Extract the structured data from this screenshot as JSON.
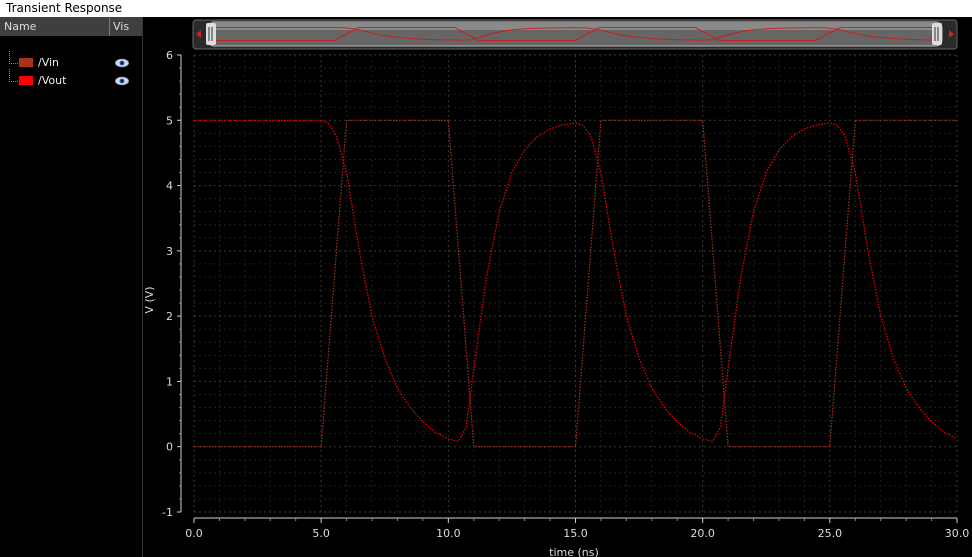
{
  "window": {
    "title": "Transient Response"
  },
  "legend": {
    "header": {
      "name": "Name",
      "vis": "Vis"
    },
    "items": [
      {
        "label": "/Vin",
        "color": "#a8321e",
        "visible_icon": "eye-icon"
      },
      {
        "label": "/Vout",
        "color": "#ff0000",
        "visible_icon": "eye-icon"
      }
    ]
  },
  "chart_data": {
    "type": "line",
    "xlabel": "time (ns)",
    "ylabel": "V (V)",
    "xlim": [
      0,
      30
    ],
    "ylim": [
      -1,
      6
    ],
    "xticks": [
      "0.0",
      "5.0",
      "10.0",
      "15.0",
      "20.0",
      "25.0",
      "30.0"
    ],
    "yticks": [
      "-1",
      "0",
      "1",
      "2",
      "3",
      "4",
      "5",
      "6"
    ],
    "grid": true,
    "series": [
      {
        "name": "/Vin",
        "color": "#a8321e",
        "x": [
          0,
          5.0,
          6.0,
          10.0,
          11.0,
          15.0,
          16.0,
          20.0,
          21.0,
          25.0,
          26.0,
          30.0
        ],
        "y": [
          0,
          0,
          5,
          5,
          0,
          0,
          5,
          5,
          0,
          0,
          5,
          5
        ]
      },
      {
        "name": "/Vout",
        "color": "#ff0000",
        "x": [
          0,
          5.0,
          5.3,
          5.6,
          6.0,
          6.5,
          7.0,
          7.5,
          8.0,
          8.5,
          9.0,
          9.5,
          10.0,
          10.4,
          10.7,
          11.0,
          11.5,
          12.0,
          12.5,
          13.0,
          13.5,
          14.0,
          14.5,
          15.0,
          15.3,
          15.6,
          16.0,
          16.5,
          17.0,
          17.5,
          18.0,
          18.5,
          19.0,
          19.5,
          20.0,
          20.4,
          20.7,
          21.0,
          21.5,
          22.0,
          22.5,
          23.0,
          23.5,
          24.0,
          24.5,
          25.0,
          25.3,
          25.6,
          26.0,
          26.5,
          27.0,
          27.5,
          28.0,
          28.5,
          29.0,
          29.5,
          30.0
        ],
        "y": [
          5,
          5,
          4.95,
          4.75,
          4.2,
          3.0,
          2.0,
          1.35,
          0.9,
          0.6,
          0.38,
          0.22,
          0.12,
          0.08,
          0.3,
          1.2,
          2.6,
          3.6,
          4.2,
          4.55,
          4.75,
          4.87,
          4.93,
          4.96,
          4.92,
          4.75,
          4.2,
          3.0,
          2.0,
          1.35,
          0.9,
          0.6,
          0.38,
          0.22,
          0.12,
          0.08,
          0.3,
          1.2,
          2.6,
          3.6,
          4.2,
          4.55,
          4.75,
          4.87,
          4.93,
          4.96,
          4.92,
          4.75,
          4.2,
          3.0,
          2.0,
          1.35,
          0.9,
          0.6,
          0.38,
          0.22,
          0.12
        ]
      }
    ]
  }
}
